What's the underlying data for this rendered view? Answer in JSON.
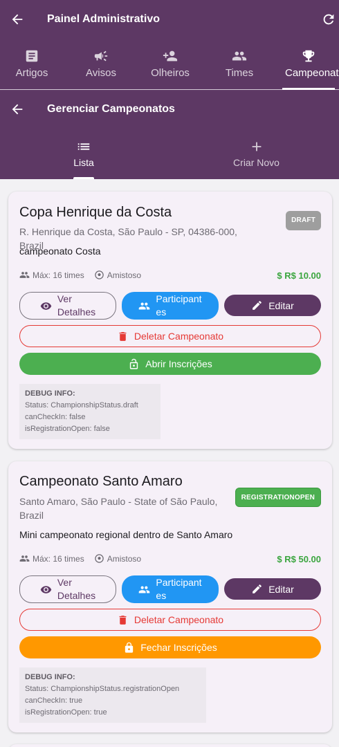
{
  "appbar": {
    "title": "Painel Administrativo"
  },
  "main_tabs": [
    {
      "label": "Artigos",
      "icon": "article-icon"
    },
    {
      "label": "Avisos",
      "icon": "megaphone-icon"
    },
    {
      "label": "Olheiros",
      "icon": "person-add-icon"
    },
    {
      "label": "Times",
      "icon": "group-icon"
    },
    {
      "label": "Campeonatos",
      "icon": "trophy-icon",
      "active": true
    }
  ],
  "subbar": {
    "title": "Gerenciar Campeonatos"
  },
  "sub_tabs": [
    {
      "label": "Lista",
      "icon": "list-icon",
      "active": true
    },
    {
      "label": "Criar Novo",
      "icon": "plus-icon"
    }
  ],
  "championships": [
    {
      "name": "Copa Henrique da Costa",
      "address": "R. Henrique da Costa, São Paulo - SP, 04386-000, Brazil",
      "description": "campeonato Costa",
      "status_badge": "DRAFT",
      "badge_color": "#9e9e9e",
      "max_teams": "Máx: 16 times",
      "type": "Amistoso",
      "price": "$ R$ 10.00",
      "buttons": {
        "details_line1": "Ver",
        "details_line2": "Detalhes",
        "participants_line1": "Participant",
        "participants_line2": "es",
        "edit": "Editar",
        "delete": "Deletar Campeonato",
        "registration": "Abrir Inscrições"
      },
      "debug": {
        "header": "DEBUG INFO:",
        "status": "Status: ChampionshipStatus.draft",
        "can_check_in": "canCheckIn: false",
        "is_registration_open": "isRegistrationOpen: false"
      }
    },
    {
      "name": "Campeonato Santo Amaro",
      "address": "Santo Amaro, São Paulo - State of São Paulo, Brazil",
      "description": "Mini campeonato regional dentro de Santo Amaro",
      "status_badge": "REGISTRATIONOPEN",
      "badge_color": "#4caf50",
      "max_teams": "Máx: 16 times",
      "type": "Amistoso",
      "price": "$ R$ 50.00",
      "buttons": {
        "details_line1": "Ver",
        "details_line2": "Detalhes",
        "participants_line1": "Participant",
        "participants_line2": "es",
        "edit": "Editar",
        "delete": "Deletar Campeonato",
        "registration": "Fechar Inscrições"
      },
      "debug": {
        "header": "DEBUG INFO:",
        "status": "Status: ChampionshipStatus.registrationOpen",
        "can_check_in": "canCheckIn: true",
        "is_registration_open": "isRegistrationOpen: true"
      }
    }
  ],
  "colors": {
    "primary": "#5d3864",
    "blue": "#2196f3",
    "green": "#4caf50",
    "orange": "#ff9800",
    "danger": "#e53935",
    "price": "#3aa53e"
  }
}
